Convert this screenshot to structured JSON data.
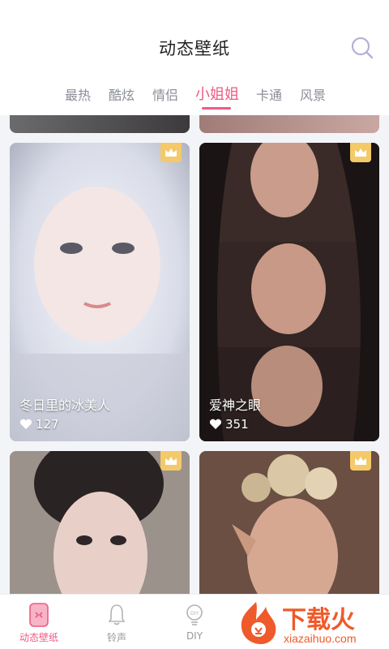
{
  "header": {
    "title": "动态壁纸"
  },
  "icons": {
    "search": "search-icon",
    "crown": "crown-icon",
    "heart": "heart-icon"
  },
  "colors": {
    "accent": "#ef5a83",
    "vip": "#f4c96a"
  },
  "tabs": [
    {
      "label": "最热",
      "active": false
    },
    {
      "label": "酷炫",
      "active": false
    },
    {
      "label": "情侣",
      "active": false
    },
    {
      "label": "小姐姐",
      "active": true
    },
    {
      "label": "卡通",
      "active": false
    },
    {
      "label": "风景",
      "active": false
    }
  ],
  "cards": [
    {
      "title": "冬日里的冰美人",
      "likes": "127",
      "vip": true
    },
    {
      "title": "爱神之眼",
      "likes": "351",
      "vip": true
    },
    {
      "title": "",
      "likes": "",
      "vip": true
    },
    {
      "title": "",
      "likes": "",
      "vip": true
    }
  ],
  "bottom_nav": [
    {
      "label": "动态壁纸",
      "active": true
    },
    {
      "label": "铃声",
      "active": false
    },
    {
      "label": "DIY",
      "active": false
    }
  ],
  "watermark": {
    "brand": "下载火",
    "url": "xiazaihuo.com"
  }
}
